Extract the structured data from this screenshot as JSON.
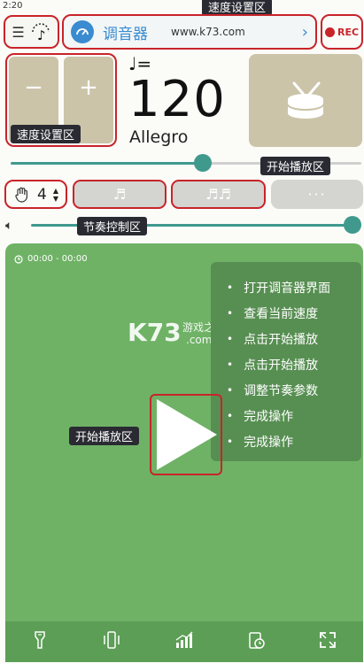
{
  "status_bar": {
    "time": "2:20"
  },
  "header": {
    "tuner_label": "调音器",
    "url": "www.k73.com",
    "rec_label": "REC"
  },
  "annotations": {
    "top_speed": "速度设置区",
    "speed_box": "速度设置区",
    "play_area_top": "开始播放区",
    "rhythm": "节奏控制区",
    "play_area_main": "开始播放区"
  },
  "speed_controls": {
    "minus": "−",
    "plus": "+"
  },
  "tempo": {
    "note_symbol": "♩=",
    "bpm": "120",
    "name": "Allegro"
  },
  "tempo_slider": {
    "value_fraction": 0.55
  },
  "rhythm_row": {
    "beats": "4",
    "more": "···"
  },
  "volume_slider": {
    "value_fraction": 1.0
  },
  "player": {
    "time_range": "00:00 - 00:00",
    "watermark": "K73",
    "watermark_sub": "游戏之家",
    "watermark_com": ".com",
    "steps": [
      "打开调音器界面",
      "查看当前速度",
      "点击开始播放",
      "点击开始播放",
      "调整节奏参数",
      "完成操作",
      "完成操作"
    ]
  },
  "icons": {
    "menu": "menu-icon",
    "metronome": "metronome-icon",
    "tuner": "tuner-dial-icon",
    "drum": "drum-icon",
    "hand": "hand-icon",
    "clock": "clock-icon",
    "volume": "volume-icon",
    "play": "play-icon",
    "flashlight": "flashlight-icon",
    "vibrate": "vibrate-icon",
    "stats": "stats-icon",
    "timer": "timer-icon",
    "fullscreen": "fullscreen-icon"
  },
  "colors": {
    "accent": "#3f9a8d",
    "annotation": "#c8242a",
    "panel": "#6fb266",
    "tile": "#cbc4a9",
    "tuner_blue": "#3a8bd0"
  }
}
